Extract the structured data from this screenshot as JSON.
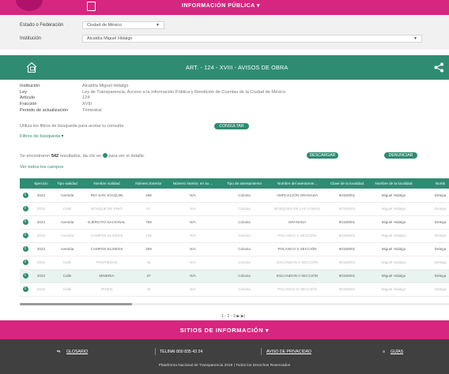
{
  "header": {
    "title": "INFORMACIÓN PÚBLICA ▾",
    "icon": "document-icon"
  },
  "filters": {
    "estado_label": "Estado o Federación",
    "estado_value": "Ciudad de México",
    "institucion_label": "Institución",
    "institucion_value": "Alcaldía Miguel Hidalgo"
  },
  "section": {
    "title": "ART. - 124 - XVIII - AVISOS DE OBRA",
    "icon": "house-icon",
    "share_icon": "share-icon"
  },
  "info": [
    {
      "k": "Institución",
      "v": "Alcaldía Miguel Hidalgo"
    },
    {
      "k": "Ley",
      "v": "Ley de Transparencia, Acceso a la Información Pública y Rendición de Cuentas de la Ciudad de México"
    },
    {
      "k": "Artículo",
      "v": "124"
    },
    {
      "k": "Fracción",
      "v": "XVIII"
    },
    {
      "k": "Periodo de actualización",
      "v": "Trimestral"
    }
  ],
  "hint": "Utiliza los filtros de búsqueda para acotar tu consulta",
  "buttons": {
    "consultar": "CONSULTAR",
    "descargar": "DESCARGAR",
    "denunciar": "DENUNCIAR"
  },
  "links": {
    "filtros": "Filtros de búsqueda ▾",
    "ver_todos": "Ver todos los campos"
  },
  "results": {
    "prefix": "Se encontraron ",
    "count": "542",
    "suffix": " resultados, da clic en ",
    "suffix2": " para ver el detalle."
  },
  "table": {
    "headers": [
      "",
      "Ejercicio",
      "Tipo vialidad",
      "Nombre vialidad",
      "Número Exterior",
      "Número Interior, en su ...",
      "Tipo de asentamiento",
      "Nombre del asentamie...",
      "Clave de la localidad",
      "Nombre de la localidad",
      "Nomb"
    ],
    "rows": [
      {
        "style": "normal",
        "cells": [
          "2022",
          "Avenida",
          "RIO SAN JOAQUIN",
          "498",
          "N/A",
          "Colonia",
          "AMPLIACIÓN GRANADA",
          "90160001",
          "Miguel Hidalgo",
          "Delega"
        ]
      },
      {
        "style": "faded",
        "cells": [
          "2022",
          "Calle",
          "BOSQUE DE PINO",
          "57",
          "N/A",
          "Colonia",
          "BOSQUES DE LAS LOMAS",
          "90160001",
          "Miguel Hidalgo",
          "Delega"
        ]
      },
      {
        "style": "normal",
        "cells": [
          "2022",
          "Avenida",
          "EJÉRCITO NACIONAL",
          "769",
          "N/A",
          "Colonia",
          "GRANADA",
          "90160001",
          "Miguel Hidalgo",
          "Delega"
        ]
      },
      {
        "style": "faded",
        "cells": [
          "2022",
          "Avenida",
          "CAMPOS ELISEOS",
          "135",
          "N/A",
          "Colonia",
          "POLANCO V SECCIÓN",
          "90160001",
          "Miguel Hidalgo",
          "Delega"
        ]
      },
      {
        "style": "normal",
        "cells": [
          "2022",
          "Avenida",
          "CAMPOS ELISEOS",
          "369",
          "N/A",
          "Colonia",
          "POLANCO V SECCIÓN",
          "90160001",
          "Miguel Hidalgo",
          "Delega"
        ]
      },
      {
        "style": "faded",
        "cells": [
          "2022",
          "Calle",
          "PROPIEDAD",
          "42",
          "N/A",
          "Colonia",
          "ESCANDON II SECCIÓN",
          "90160001",
          "Miguel Hidalgo",
          "Delega"
        ]
      },
      {
        "style": "hl",
        "cells": [
          "2022",
          "Calle",
          "MINERIA",
          "37",
          "N/A",
          "Colonia",
          "ESCANDON II SECCIÓN",
          "90160001",
          "Miguel Hidalgo",
          "Delega"
        ]
      },
      {
        "style": "faded",
        "cells": [
          "2022",
          "Calle",
          "IRSEN",
          "40",
          "N/A",
          "Colonia",
          "POLANCO III SECCIÓN",
          "90160001",
          "Miguel Hidalgo",
          "Delega"
        ]
      }
    ]
  },
  "pager": "1 - 2 - 3 ▶ ▶|",
  "bottom": {
    "sitios": "SITIOS DE INFORMACIÓN ▾"
  },
  "footer": {
    "glosario": "GLOSARIO",
    "telinai": "TELINAI 800 835 43 24",
    "aviso": "AVISO DE PRIVACIDAD",
    "guias": "GUÍAS",
    "note": "Plataforma Nacional de Transparencia 2019 | Todos los Derechos Reservados"
  },
  "colors": {
    "magenta": "#d6267f",
    "green": "#2f8c73",
    "footer": "#404040"
  }
}
